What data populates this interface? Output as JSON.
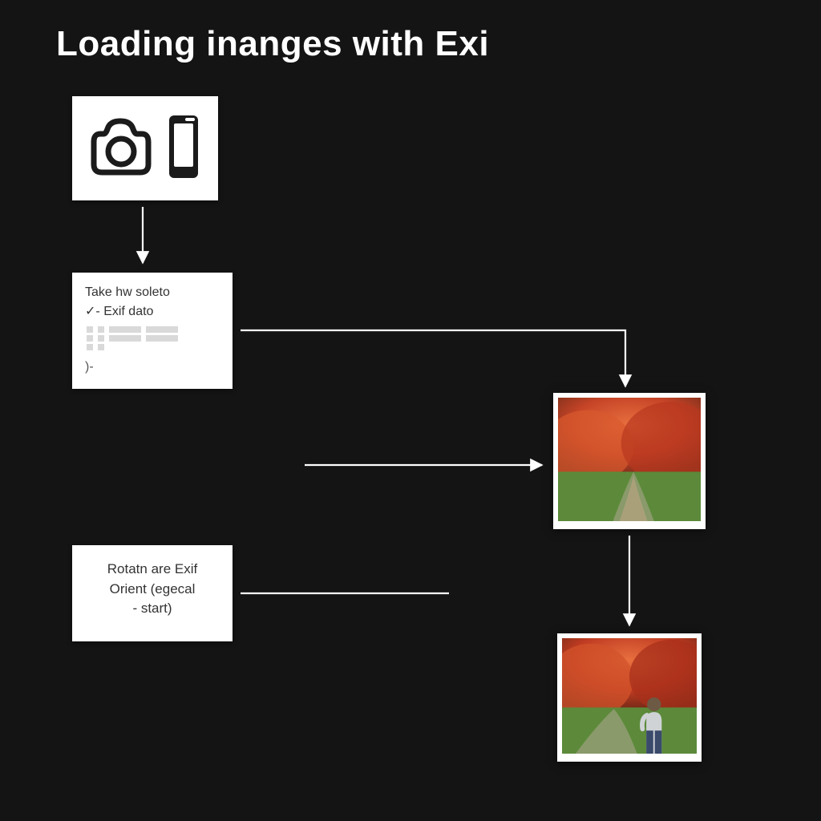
{
  "title": "Loading inanges with Exi",
  "nodes": {
    "camera": {
      "icon1": "camera-icon",
      "icon2": "phone-icon"
    },
    "exif": {
      "line1": "Take hw soleto",
      "line2_prefix": "✓- ",
      "line2": "Exif dato",
      "lastline": ")-"
    },
    "rotate": {
      "line1": "Rotatn are Exif",
      "line2": "Orient (egecal",
      "line3": "- start)"
    }
  },
  "photos": {
    "photo1_alt": "autumn-foliage-path",
    "photo2_alt": "autumn-foliage-person"
  },
  "colors": {
    "bg": "#141414",
    "card": "#ffffff",
    "text": "#333333"
  }
}
